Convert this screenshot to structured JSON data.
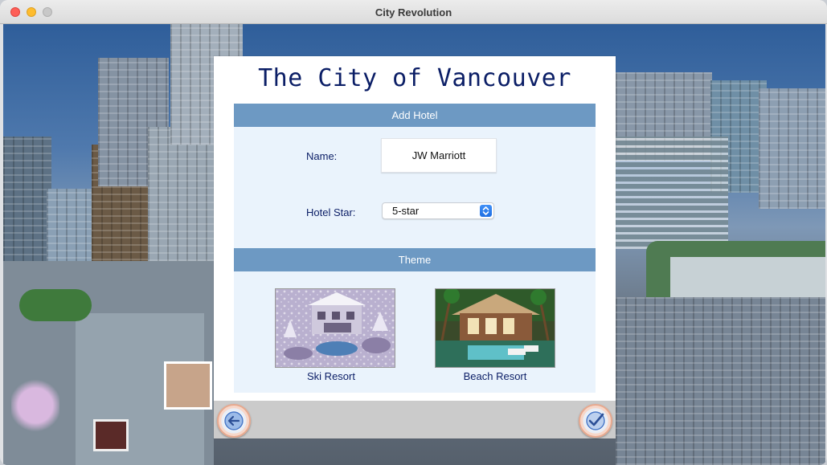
{
  "window": {
    "title": "City Revolution"
  },
  "dialog": {
    "title": "The City of Vancouver",
    "add_hotel": {
      "header": "Add Hotel",
      "name_label": "Name:",
      "name_value": "JW Marriott",
      "star_label": "Hotel Star:",
      "star_value": "5-star"
    },
    "theme": {
      "header": "Theme",
      "options": [
        {
          "label": "Ski Resort",
          "image": "snowy-lodge-image"
        },
        {
          "label": "Beach Resort",
          "image": "tropical-villa-image"
        }
      ]
    },
    "footer": {
      "back_icon": "back-arrow-icon",
      "confirm_icon": "checkmark-icon"
    }
  },
  "colors": {
    "title_text": "#0b1e66",
    "section_header": "#6d99c3",
    "panel_bg": "#eaf3fc",
    "footer_bg": "#cbcbcb"
  }
}
